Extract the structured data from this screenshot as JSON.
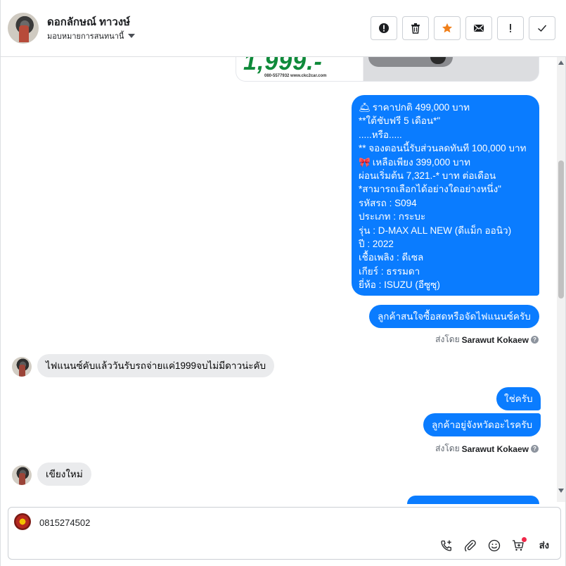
{
  "header": {
    "contact_name": "ดอกลักษณ์ ทาวงษ์",
    "assign_label": "มอบหมายการสนทนานี้",
    "actions": [
      {
        "name": "spam-button",
        "icon": "alert-circle-icon"
      },
      {
        "name": "delete-button",
        "icon": "trash-icon"
      },
      {
        "name": "star-button",
        "icon": "star-icon"
      },
      {
        "name": "mark-unread-button",
        "icon": "envelope-icon"
      },
      {
        "name": "follow-up-button",
        "icon": "exclamation-icon"
      },
      {
        "name": "done-button",
        "icon": "check-icon"
      }
    ]
  },
  "image_message": {
    "price_text": "1,999.-",
    "contact_text": "080-5577932 www.ckc2car.com"
  },
  "messages": {
    "long_offer": [
      {
        "emoji": "🛎",
        "text": "  ราคาปกติ 499,000 บาท"
      },
      {
        "emoji": "",
        "text": "          **ใต้ชับฟรี 5 เดือน*\""
      },
      {
        "emoji": "",
        "text": ".....หรือ....."
      },
      {
        "emoji": "",
        "text": "** จองตอนนี้รับส่วนลดทันที 100,000 บาท"
      },
      {
        "emoji": "🎀",
        "text": " เหลือเพียง 399,000 บาท"
      },
      {
        "emoji": "",
        "text": "ผ่อนเริ่มต้น 7,321.-* บาท ต่อเดือน"
      },
      {
        "emoji": "",
        "text": "*สามารถเลือกได้อย่างใดอย่างหนึ่ง\""
      },
      {
        "emoji": "",
        "text": "   รหัสรถ : S094"
      },
      {
        "emoji": "",
        "text": "   ประเภท : กระบะ"
      },
      {
        "emoji": "",
        "text": "   รุ่น : D-MAX ALL NEW (ดีแม็ก ออนิว)"
      },
      {
        "emoji": "",
        "text": "   ปี : 2022"
      },
      {
        "emoji": "",
        "text": "   เชื้อเพลิง : ดีเซล"
      },
      {
        "emoji": "",
        "text": "   เกียร์ : ธรรมดา"
      },
      {
        "emoji": "",
        "text": "   ยี่ห้อ : ISUZU (อีซูซุ)"
      }
    ],
    "out_1": "ลูกค้าสนใจซื้อสดหรือจัดไฟแนนซ์ครับ",
    "sent_by_prefix": "ส่งโดย",
    "sent_by_name": "Sarawut Kokaew",
    "in_1": "ไฟแนนซ์คับแล้ววันรับรถจ่ายแค่1999จบไม่มีดาวน่ะคับ",
    "out_2": "ใช่ครับ",
    "out_3": "ลูกค้าอยู่จังหวัดอะไรครับ",
    "in_2": "เขียงใหม่"
  },
  "composer": {
    "text": "0815274502",
    "send_label": "ส่ง"
  },
  "colors": {
    "outgoing_bubble": "#0a7cff",
    "incoming_bubble": "#eaebed",
    "star": "#f07f1a"
  }
}
